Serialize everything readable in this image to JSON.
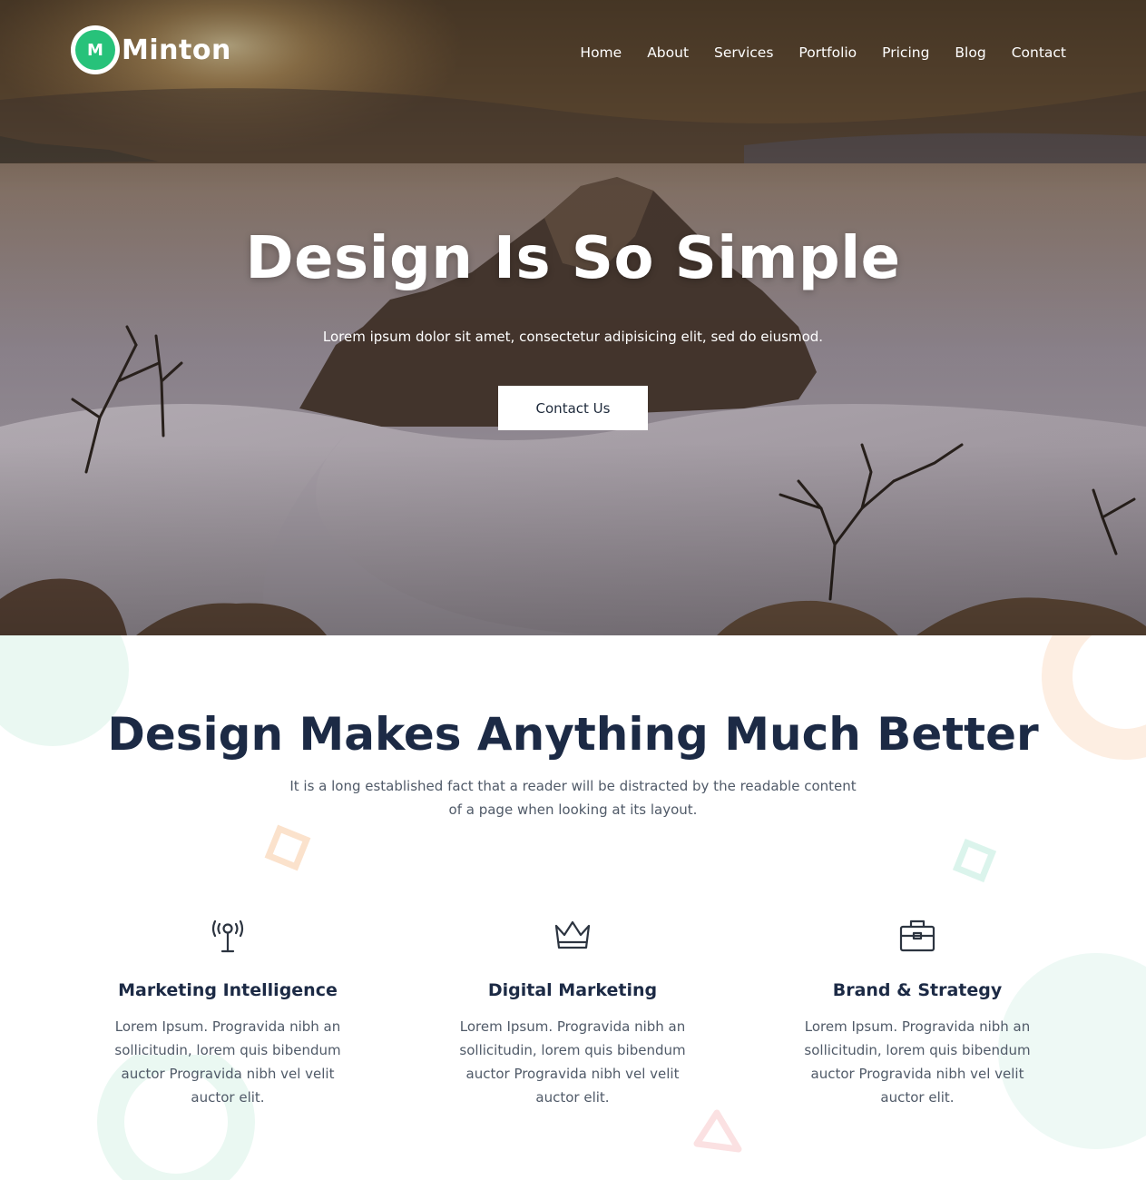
{
  "brand": {
    "logo_letter": "M",
    "name": "Minton",
    "accent_color": "#27c27a"
  },
  "nav": {
    "items": [
      {
        "label": "Home"
      },
      {
        "label": "About"
      },
      {
        "label": "Services"
      },
      {
        "label": "Portfolio"
      },
      {
        "label": "Pricing"
      },
      {
        "label": "Blog"
      },
      {
        "label": "Contact"
      }
    ]
  },
  "hero": {
    "title": "Design Is So Simple",
    "subtitle": "Lorem ipsum dolor sit amet, consectetur adipisicing elit, sed do eiusmod.",
    "cta_label": "Contact Us"
  },
  "features": {
    "title": "Design Makes Anything Much Better",
    "description": "It is a long established fact that a reader will be distracted by the readable content of a page when looking at its layout.",
    "cards": [
      {
        "icon": "antenna-icon",
        "title": "Marketing Intelligence",
        "text": "Lorem Ipsum. Progravida nibh an sollicitudin, lorem quis bibendum auctor Progravida nibh vel velit auctor elit."
      },
      {
        "icon": "crown-icon",
        "title": "Digital Marketing",
        "text": "Lorem Ipsum. Progravida nibh an sollicitudin, lorem quis bibendum auctor Progravida nibh vel velit auctor elit."
      },
      {
        "icon": "briefcase-icon",
        "title": "Brand & Strategy",
        "text": "Lorem Ipsum. Progravida nibh an sollicitudin, lorem quis bibendum auctor Progravida nibh vel velit auctor elit."
      }
    ]
  },
  "colors": {
    "heading": "#1c2a45",
    "body_text": "#505a68",
    "deco_mint": "#e6f7f0",
    "deco_peach": "#fdeadb",
    "deco_pink": "#fbe0e0"
  }
}
